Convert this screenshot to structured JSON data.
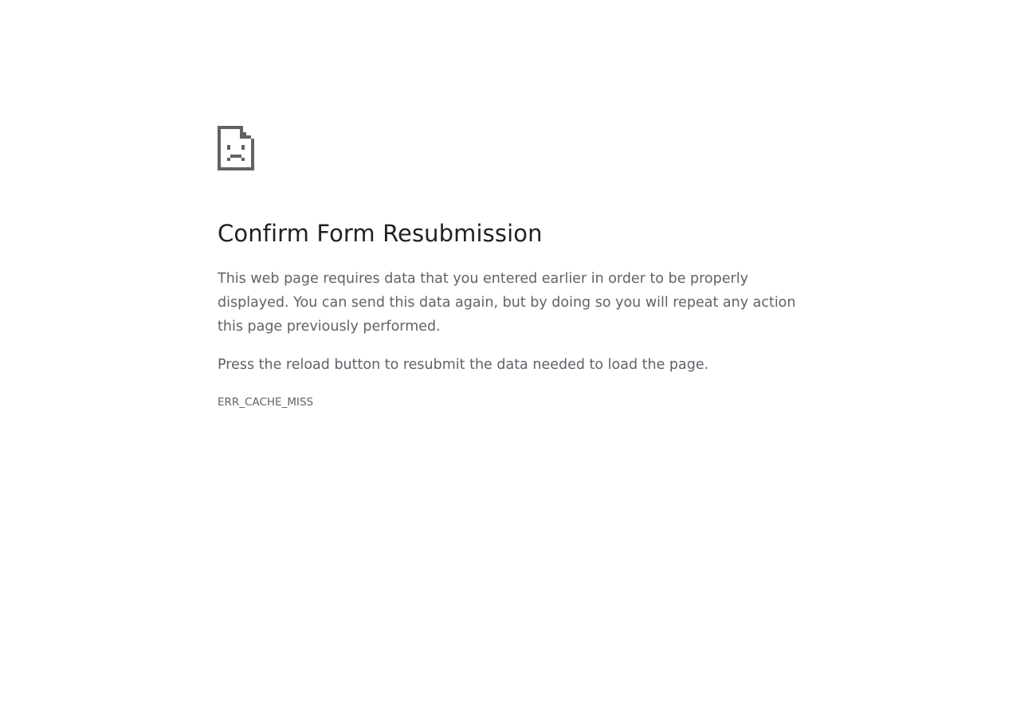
{
  "error_page": {
    "icon": "sad-page-icon",
    "title": "Confirm Form Resubmission",
    "description": "This web page requires data that you entered earlier in order to be properly displayed. You can send this data again, but by doing so you will repeat any action this page previously performed.",
    "hint": "Press the reload button to resubmit the data needed to load the page.",
    "error_code": "ERR_CACHE_MISS"
  },
  "colors": {
    "background": "#ffffff",
    "title": "#202124",
    "body_text": "#5f6368",
    "icon": "#5f6368"
  }
}
